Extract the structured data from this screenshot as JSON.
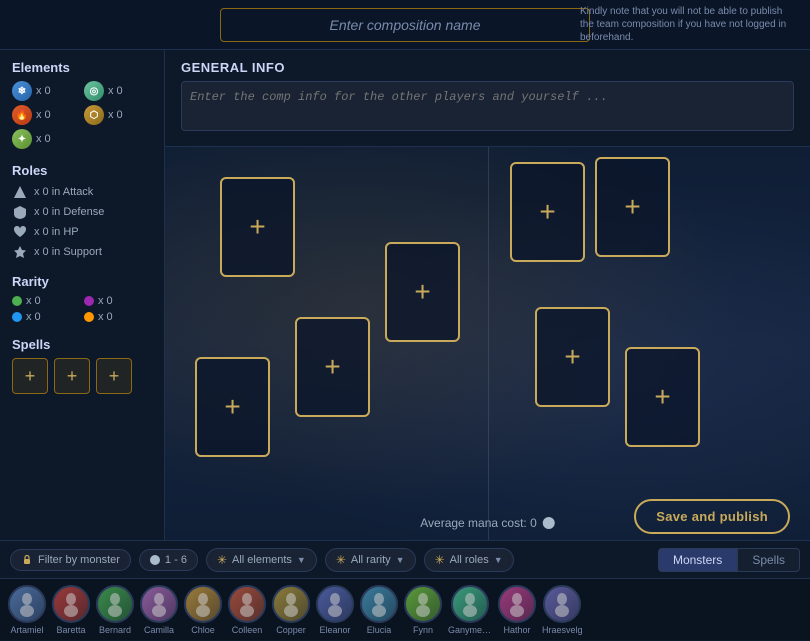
{
  "header": {
    "input_placeholder": "Enter composition name",
    "note": "Kindly note that you will not be able to publish the team composition if you have not logged in beforehand."
  },
  "sidebar": {
    "elements_title": "Elements",
    "elements": [
      {
        "name": "ice",
        "class": "el-ice",
        "symbol": "❄",
        "count": "x 0"
      },
      {
        "name": "wind",
        "class": "el-wind",
        "symbol": "◎",
        "count": "x 0"
      },
      {
        "name": "fire",
        "class": "el-fire",
        "symbol": "🔥",
        "count": "x 0"
      },
      {
        "name": "earth",
        "class": "el-earth",
        "symbol": "⬡",
        "count": "x 0"
      },
      {
        "name": "light",
        "class": "el-light",
        "symbol": "✦",
        "count": "x 0"
      }
    ],
    "roles_title": "Roles",
    "roles": [
      {
        "name": "attack",
        "label": "x 0 in Attack"
      },
      {
        "name": "defense",
        "label": "x 0 in Defense"
      },
      {
        "name": "hp",
        "label": "x 0 in HP"
      },
      {
        "name": "support",
        "label": "x 0 in Support"
      }
    ],
    "rarity_title": "Rarity",
    "rarities": [
      {
        "color": "dot-green",
        "count": "x 0"
      },
      {
        "color": "dot-purple",
        "count": "x 0"
      },
      {
        "color": "dot-blue",
        "count": "x 0"
      },
      {
        "color": "dot-orange",
        "count": "x 0"
      }
    ],
    "spells_title": "Spells",
    "spell_slots": [
      "+",
      "+",
      "+"
    ]
  },
  "general_info": {
    "title": "GENERAL INFO",
    "placeholder": "Enter the comp info for the other players and yourself ..."
  },
  "battle_field": {
    "mana_cost_label": "Average mana cost: 0",
    "save_btn_label": "Save and publish",
    "card_slots": 8
  },
  "filter_bar": {
    "filter_by_monster": "Filter by monster",
    "range_label": "1 - 6",
    "all_elements": "All elements",
    "all_rarity": "All rarity",
    "all_roles": "All roles",
    "tab_monsters": "Monsters",
    "tab_spells": "Spells"
  },
  "monsters": [
    {
      "name": "Artamiel",
      "color": "#3a5a8a"
    },
    {
      "name": "Baretta",
      "color": "#8a3a3a"
    },
    {
      "name": "Bernard",
      "color": "#3a7a4a"
    },
    {
      "name": "Camilla",
      "color": "#7a5a8a"
    },
    {
      "name": "Chloe",
      "color": "#8a6a3a"
    },
    {
      "name": "Colleen",
      "color": "#8a4a3a"
    },
    {
      "name": "Copper",
      "color": "#7a6a3a"
    },
    {
      "name": "Eleanor",
      "color": "#4a5a8a"
    },
    {
      "name": "Elucia",
      "color": "#3a6a8a"
    },
    {
      "name": "Fynn",
      "color": "#5a8a3a"
    },
    {
      "name": "Ganymede",
      "color": "#3a8a6a"
    },
    {
      "name": "Hathor",
      "color": "#8a3a6a"
    },
    {
      "name": "Hraesvelg",
      "color": "#5a5a8a"
    }
  ]
}
